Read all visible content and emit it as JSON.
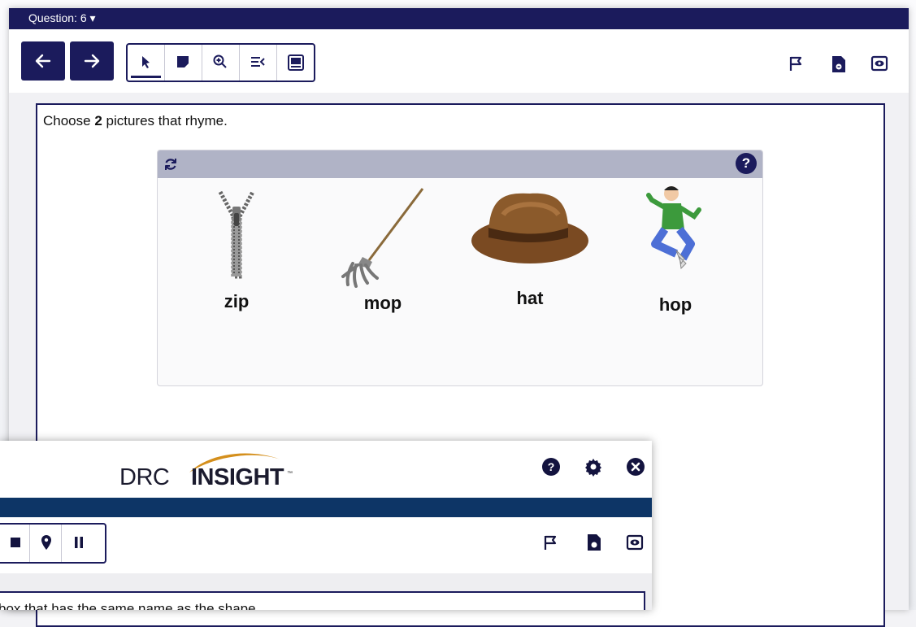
{
  "header": {
    "question_label": "Question: 6 ▾"
  },
  "toolbar": {
    "back_icon": "arrow-left-icon",
    "next_icon": "arrow-right-icon",
    "tools": [
      "pointer-icon",
      "sticky-note-icon",
      "zoom-in-icon",
      "line-reader-icon",
      "answer-masking-icon"
    ],
    "right_icons": [
      "flag-icon",
      "audio-file-icon",
      "eye-icon"
    ]
  },
  "item": {
    "prompt_before": "Choose ",
    "prompt_bold": "2",
    "prompt_after": " pictures that rhyme.",
    "help_label": "?",
    "choices": [
      {
        "label": "zip",
        "icon": "zipper-icon"
      },
      {
        "label": "mop",
        "icon": "mop-icon"
      },
      {
        "label": "hat",
        "icon": "hat-icon"
      },
      {
        "label": "hop",
        "icon": "hopping-boy-icon"
      }
    ]
  },
  "popup": {
    "logo_left": "DRC",
    "logo_right": "INSIGHT",
    "logo_tm": "™",
    "help_label": "?",
    "prompt_fragment": "box that has the same name as the shape."
  },
  "colors": {
    "navy": "#1b1b5c",
    "widget_header": "#b0b3c6",
    "popup_band": "#0d3566"
  }
}
